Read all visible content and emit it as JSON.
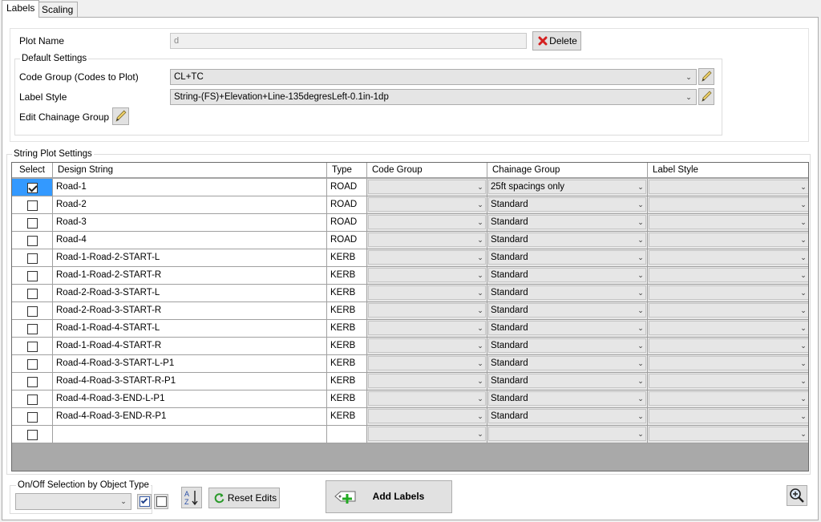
{
  "tabs": [
    {
      "label": "Labels",
      "active": true
    },
    {
      "label": "Scaling",
      "active": false
    }
  ],
  "plot": {
    "name_label": "Plot Name",
    "name_value": "d",
    "delete_label": "Delete"
  },
  "default_settings": {
    "title": "Default Settings",
    "code_group_label": "Code Group (Codes to Plot)",
    "code_group_value": "CL+TC",
    "label_style_label": "Label Style",
    "label_style_value": "String-(FS)+Elevation+Line-135degresLeft-0.1in-1dp",
    "edit_chainage_label": "Edit Chainage Group"
  },
  "string_plot": {
    "title": "String Plot Settings",
    "columns": [
      "Select",
      "Design String",
      "Type",
      "Code Group",
      "Chainage Group",
      "Label Style"
    ],
    "rows": [
      {
        "selected": true,
        "design": "Road-1",
        "type": "ROAD",
        "code": "",
        "chainage": "25ft spacings only",
        "style": ""
      },
      {
        "selected": false,
        "design": "Road-2",
        "type": "ROAD",
        "code": "",
        "chainage": "Standard",
        "style": ""
      },
      {
        "selected": false,
        "design": "Road-3",
        "type": "ROAD",
        "code": "",
        "chainage": "Standard",
        "style": ""
      },
      {
        "selected": false,
        "design": "Road-4",
        "type": "ROAD",
        "code": "",
        "chainage": "Standard",
        "style": ""
      },
      {
        "selected": false,
        "design": "Road-1-Road-2-START-L",
        "type": "KERB",
        "code": "",
        "chainage": "Standard",
        "style": ""
      },
      {
        "selected": false,
        "design": "Road-1-Road-2-START-R",
        "type": "KERB",
        "code": "",
        "chainage": "Standard",
        "style": ""
      },
      {
        "selected": false,
        "design": "Road-2-Road-3-START-L",
        "type": "KERB",
        "code": "",
        "chainage": "Standard",
        "style": ""
      },
      {
        "selected": false,
        "design": "Road-2-Road-3-START-R",
        "type": "KERB",
        "code": "",
        "chainage": "Standard",
        "style": ""
      },
      {
        "selected": false,
        "design": "Road-1-Road-4-START-L",
        "type": "KERB",
        "code": "",
        "chainage": "Standard",
        "style": ""
      },
      {
        "selected": false,
        "design": "Road-1-Road-4-START-R",
        "type": "KERB",
        "code": "",
        "chainage": "Standard",
        "style": ""
      },
      {
        "selected": false,
        "design": "Road-4-Road-3-START-L-P1",
        "type": "KERB",
        "code": "",
        "chainage": "Standard",
        "style": ""
      },
      {
        "selected": false,
        "design": "Road-4-Road-3-START-R-P1",
        "type": "KERB",
        "code": "",
        "chainage": "Standard",
        "style": ""
      },
      {
        "selected": false,
        "design": "Road-4-Road-3-END-L-P1",
        "type": "KERB",
        "code": "",
        "chainage": "Standard",
        "style": ""
      },
      {
        "selected": false,
        "design": "Road-4-Road-3-END-R-P1",
        "type": "KERB",
        "code": "",
        "chainage": "Standard",
        "style": ""
      },
      {
        "selected": false,
        "design": "",
        "type": "",
        "code": "",
        "chainage": "",
        "style": ""
      }
    ]
  },
  "bottom": {
    "onoff_title": "On/Off Selection by Object Type",
    "onoff_value": "",
    "reset_label": "Reset Edits",
    "add_labels_label": "Add Labels"
  },
  "icons": {
    "delete": "delete-x-icon",
    "pencil": "pencil-icon",
    "sort": "sort-az-icon",
    "reset": "reset-icon",
    "add_labels": "add-labels-icon",
    "zoom": "zoom-icon"
  },
  "colors": {
    "selection": "#3399ff",
    "delete_red": "#d42020",
    "add_green": "#22aa22"
  }
}
